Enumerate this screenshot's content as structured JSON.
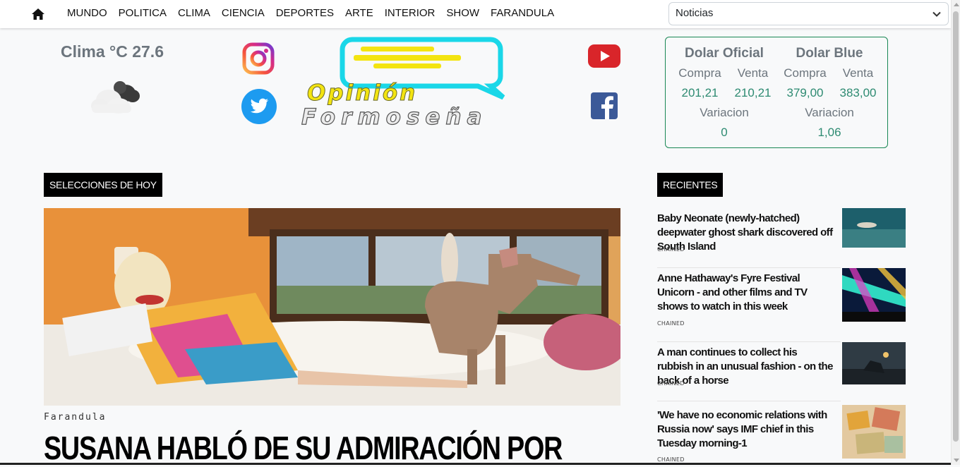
{
  "nav": {
    "home_icon": "home-icon",
    "items": [
      "MUNDO",
      "POLITICA",
      "CLIMA",
      "CIENCIA",
      "DEPORTES",
      "ARTE",
      "INTERIOR",
      "SHOW",
      "FARANDULA"
    ]
  },
  "section_select": {
    "value": "Noticias",
    "icon": "chevron-down-icon"
  },
  "weather": {
    "text": "Clima °C 27.6",
    "icon": "cloud-icon"
  },
  "social": {
    "instagram": "instagram-icon",
    "twitter": "twitter-icon",
    "youtube": "youtube-icon",
    "facebook": "facebook-icon"
  },
  "logo": {
    "line1": "Opinión",
    "line2": "Formoseña"
  },
  "dolar": {
    "oficial": {
      "title": "Dolar Oficial",
      "compra_label": "Compra",
      "venta_label": "Venta",
      "compra": "201,21",
      "venta": "210,21",
      "variacion_label": "Variacion",
      "variacion": "0"
    },
    "blue": {
      "title": "Dolar Blue",
      "compra_label": "Compra",
      "venta_label": "Venta",
      "compra": "379,00",
      "venta": "383,00",
      "variacion_label": "Variacion",
      "variacion": "1,06"
    }
  },
  "selecciones": {
    "tag": "SELECCIONES DE HOY",
    "category": "Farandula",
    "title": "SUSANA HABLÓ DE SU ADMIRACIÓN POR"
  },
  "recientes": {
    "tag": "RECIENTES",
    "items": [
      {
        "title": "Baby Neonate (newly-hatched) deepwater ghost shark discovered off South Island",
        "category": "CHAINED"
      },
      {
        "title": "Anne Hathaway's Fyre Festival Unicorn - and other films and TV shows to watch in this week",
        "category": "CHAINED"
      },
      {
        "title": "A man continues to collect his rubbish in an unusual fashion - on the back of a horse",
        "category": "CHAINED"
      },
      {
        "title": "'We have no economic relations with Russia now' says IMF chief in this Tuesday morning-1",
        "category": "CHAINED"
      }
    ]
  },
  "colors": {
    "accent_green": "#198754",
    "value_green": "#2e8b72",
    "tag_bg": "#000000"
  }
}
